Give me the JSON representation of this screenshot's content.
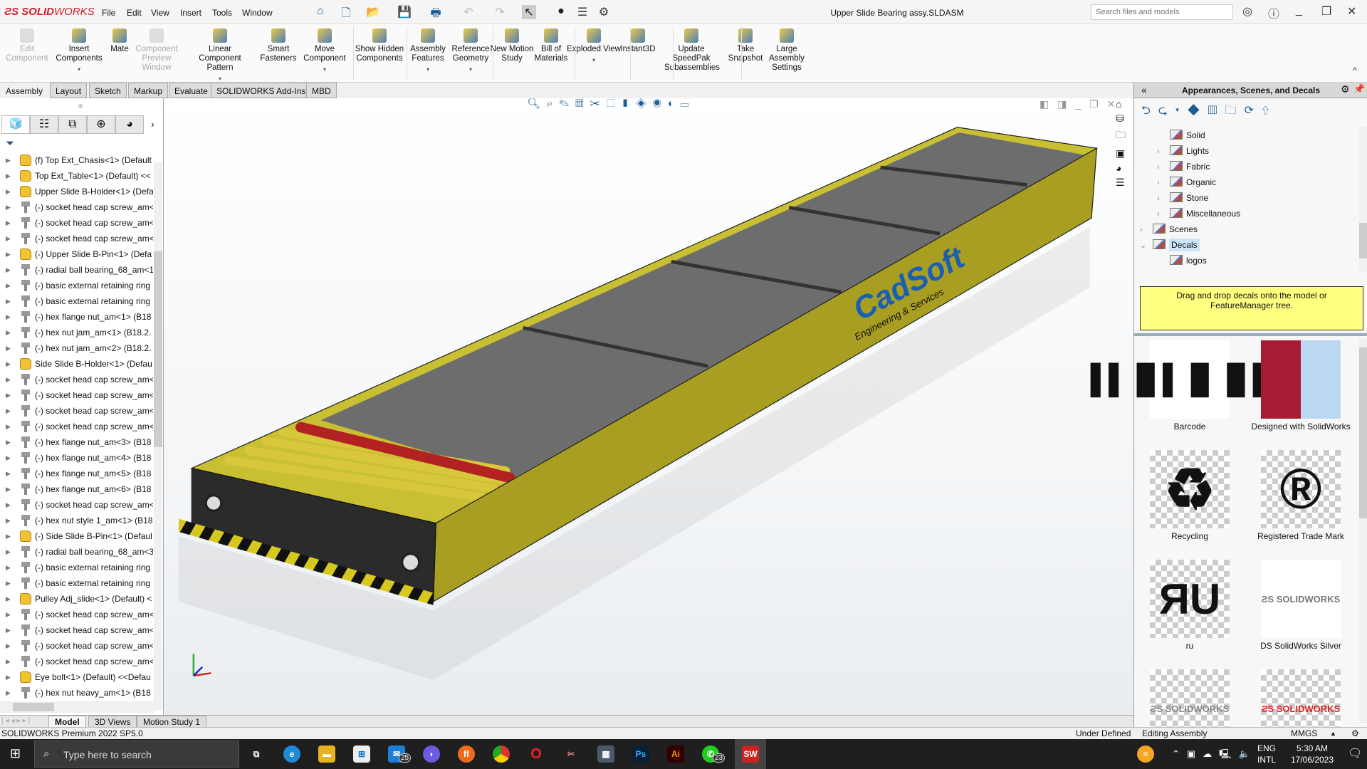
{
  "app": {
    "logo": "SOLIDWORKS",
    "title": "Upper Slide Bearing assy.SLDASM",
    "search_placeholder": "Search files and models"
  },
  "menu": [
    "File",
    "Edit",
    "View",
    "Insert",
    "Tools",
    "Window"
  ],
  "ribbon": [
    {
      "label": "Edit Component",
      "disabled": true
    },
    {
      "label": "Insert Components",
      "dd": true
    },
    {
      "label": "Mate"
    },
    {
      "label": "Component Preview Window",
      "disabled": true
    },
    {
      "label": "Linear Component Pattern",
      "dd": true
    },
    {
      "label": "Smart Fasteners"
    },
    {
      "label": "Move Component",
      "dd": true
    },
    {
      "label": "Show Hidden Components"
    },
    {
      "label": "Assembly Features",
      "dd": true
    },
    {
      "label": "Reference Geometry",
      "dd": true
    },
    {
      "label": "New Motion Study"
    },
    {
      "label": "Bill of Materials"
    },
    {
      "label": "Exploded View",
      "dd": true
    },
    {
      "label": "Instant3D"
    },
    {
      "label": "Update SpeedPak Subassemblies"
    },
    {
      "label": "Take Snapshot"
    },
    {
      "label": "Large Assembly Settings"
    }
  ],
  "tabs": [
    "Assembly",
    "Layout",
    "Sketch",
    "Markup",
    "Evaluate",
    "SOLIDWORKS Add-Ins",
    "MBD"
  ],
  "tree": [
    {
      "t": "(f) Top Ext_Chasis<1> (Default",
      "k": "asm"
    },
    {
      "t": "Top Ext_Table<1> (Default) <<",
      "k": "asm"
    },
    {
      "t": "Upper Slide B-Holder<1> (Defa",
      "k": "asm"
    },
    {
      "t": "(-) socket head cap screw_am<",
      "k": "prt"
    },
    {
      "t": "(-) socket head cap screw_am<",
      "k": "prt"
    },
    {
      "t": "(-) socket head cap screw_am<",
      "k": "prt"
    },
    {
      "t": "(-) Upper Slide B-Pin<1> (Defa",
      "k": "asm"
    },
    {
      "t": "(-) radial ball bearing_68_am<1",
      "k": "prt"
    },
    {
      "t": "(-) basic external retaining ring",
      "k": "prt"
    },
    {
      "t": "(-) basic external retaining ring",
      "k": "prt"
    },
    {
      "t": "(-) hex flange nut_am<1> (B18",
      "k": "prt"
    },
    {
      "t": "(-) hex nut jam_am<1> (B18.2.",
      "k": "prt"
    },
    {
      "t": "(-) hex nut jam_am<2> (B18.2.",
      "k": "prt"
    },
    {
      "t": "Side Slide B-Holder<1> (Defau",
      "k": "asm"
    },
    {
      "t": "(-) socket head cap screw_am<",
      "k": "prt"
    },
    {
      "t": "(-) socket head cap screw_am<",
      "k": "prt"
    },
    {
      "t": "(-) socket head cap screw_am<",
      "k": "prt"
    },
    {
      "t": "(-) socket head cap screw_am<",
      "k": "prt"
    },
    {
      "t": "(-) hex flange nut_am<3> (B18",
      "k": "prt"
    },
    {
      "t": "(-) hex flange nut_am<4> (B18",
      "k": "prt"
    },
    {
      "t": "(-) hex flange nut_am<5> (B18",
      "k": "prt"
    },
    {
      "t": "(-) hex flange nut_am<6> (B18",
      "k": "prt"
    },
    {
      "t": "(-) socket head cap screw_am<",
      "k": "prt"
    },
    {
      "t": "(-) hex nut style 1_am<1> (B18",
      "k": "prt"
    },
    {
      "t": "(-) Side Slide B-Pin<1> (Defaul",
      "k": "asm"
    },
    {
      "t": "(-) radial ball bearing_68_am<3",
      "k": "prt"
    },
    {
      "t": "(-) basic external retaining ring",
      "k": "prt"
    },
    {
      "t": "(-) basic external retaining ring",
      "k": "prt"
    },
    {
      "t": "Pulley Adj_slide<1> (Default) <",
      "k": "asm"
    },
    {
      "t": "(-) socket head cap screw_am<",
      "k": "prt"
    },
    {
      "t": "(-) socket head cap screw_am<",
      "k": "prt"
    },
    {
      "t": "(-) socket head cap screw_am<",
      "k": "prt"
    },
    {
      "t": "(-) socket head cap screw_am<",
      "k": "prt"
    },
    {
      "t": "Eye bolt<1> (Default) <<Defau",
      "k": "asm"
    },
    {
      "t": "(-) hex nut heavy_am<1> (B18",
      "k": "prt"
    }
  ],
  "model_decal": {
    "brand": "CadSoft",
    "tagline": "Engineering & Services"
  },
  "right": {
    "title": "Appearances, Scenes, and Decals",
    "items": [
      {
        "t": "Solid",
        "lv": 2,
        "exp": false
      },
      {
        "t": "Lights",
        "lv": 2,
        "exp": true
      },
      {
        "t": "Fabric",
        "lv": 2,
        "exp": true
      },
      {
        "t": "Organic",
        "lv": 2,
        "exp": true
      },
      {
        "t": "Stone",
        "lv": 2,
        "exp": true
      },
      {
        "t": "Miscellaneous",
        "lv": 2,
        "exp": true
      },
      {
        "t": "Scenes",
        "lv": 1,
        "exp": true
      },
      {
        "t": "Decals",
        "lv": 1,
        "open": true,
        "sel": true
      },
      {
        "t": "logos",
        "lv": 2
      }
    ],
    "hint": "Drag and drop decals onto the model or FeatureManager tree.",
    "decals": [
      {
        "name": "Barcode"
      },
      {
        "name": "Designed with SolidWorks"
      },
      {
        "name": "Recycling"
      },
      {
        "name": "Registered Trade Mark"
      },
      {
        "name": "ru"
      },
      {
        "name": "DS SolidWorks Silver"
      },
      {
        "name": ""
      },
      {
        "name": ""
      }
    ]
  },
  "bottom_tabs": [
    "Model",
    "3D Views",
    "Motion Study 1"
  ],
  "status": {
    "product": "SOLIDWORKS Premium 2022 SP5.0",
    "defined": "Under Defined",
    "mode": "Editing Assembly",
    "units": "MMGS"
  },
  "taskbar": {
    "search": "Type here to search",
    "lang1": "ENG",
    "lang2": "INTL",
    "time": "5:30 AM",
    "date": "17/06/2023",
    "mail_badge": "25",
    "whatsapp_badge": "23"
  },
  "colors": {
    "accent": "#d0202a",
    "frame": "#c2b82c",
    "belt": "#6a6a6a",
    "roller_red": "#b22222"
  }
}
